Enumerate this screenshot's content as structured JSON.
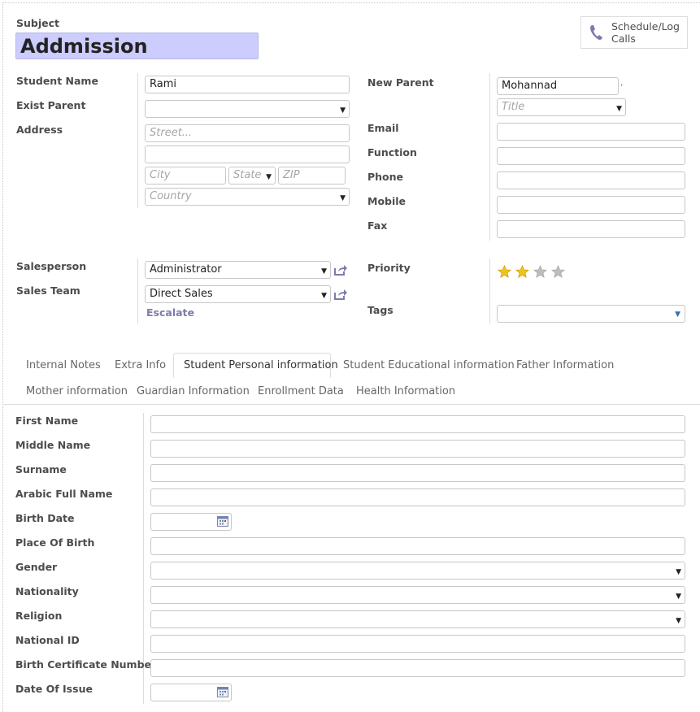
{
  "header": {
    "subject_label": "Subject",
    "subject_value": "Addmission",
    "schedule_button": "Schedule/Log Calls"
  },
  "left": {
    "student_name_label": "Student Name",
    "student_name_value": "Rami",
    "exist_parent_label": "Exist Parent",
    "exist_parent_value": "",
    "address_label": "Address",
    "street_placeholder": "Street...",
    "street2_value": "",
    "city_placeholder": "City",
    "state_placeholder": "State",
    "zip_placeholder": "ZIP",
    "country_placeholder": "Country",
    "salesperson_label": "Salesperson",
    "salesperson_value": "Administrator",
    "sales_team_label": "Sales Team",
    "sales_team_value": "Direct Sales",
    "escalate_label": "Escalate"
  },
  "right": {
    "new_parent_label": "New Parent",
    "new_parent_value": "Mohannad",
    "title_placeholder": "Title",
    "email_label": "Email",
    "function_label": "Function",
    "phone_label": "Phone",
    "mobile_label": "Mobile",
    "fax_label": "Fax",
    "priority_label": "Priority",
    "priority_value": 2,
    "priority_max": 5,
    "tags_label": "Tags"
  },
  "tabs": [
    {
      "label": "Internal Notes",
      "active": false
    },
    {
      "label": "Extra Info",
      "active": false
    },
    {
      "label": "Student Personal information",
      "active": true
    },
    {
      "label": "Student Educational information",
      "active": false
    },
    {
      "label": "Father Information",
      "active": false
    },
    {
      "label": "Mother information",
      "active": false
    },
    {
      "label": "Guardian Information",
      "active": false
    },
    {
      "label": "Enrollment Data",
      "active": false
    },
    {
      "label": "Health Information",
      "active": false
    }
  ],
  "personal": {
    "first_name": "First Name",
    "middle_name": "Middle Name",
    "surname": "Surname",
    "arabic_full_name": "Arabic Full Name",
    "birth_date": "Birth Date",
    "place_of_birth": "Place Of Birth",
    "gender": "Gender",
    "nationality": "Nationality",
    "religion": "Religion",
    "national_id": "National ID",
    "birth_certificate_number": "Birth Certificate Number",
    "date_of_issue": "Date Of Issue"
  },
  "colors": {
    "subject_bg": "#ccccff",
    "link": "#7c7bad",
    "star_on": "#f0c419",
    "star_off": "#bdbdbd"
  }
}
